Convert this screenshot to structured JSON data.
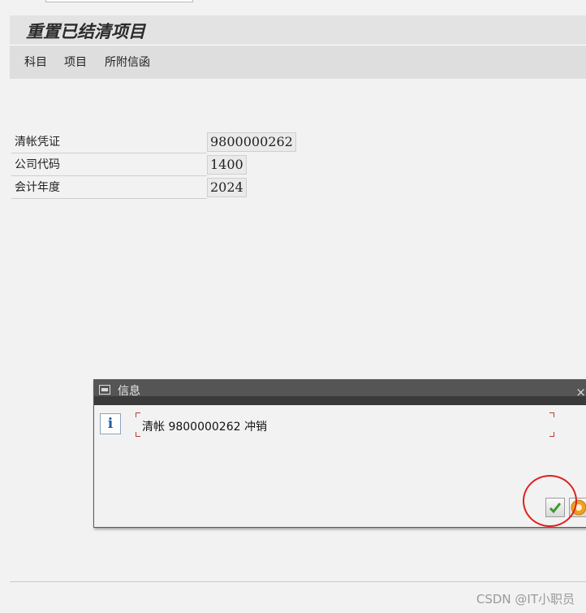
{
  "page": {
    "title": "重置已结清项目"
  },
  "menu": {
    "items": [
      {
        "label": "科目"
      },
      {
        "label": "项目"
      },
      {
        "label": "所附信函"
      }
    ]
  },
  "form": {
    "rows": [
      {
        "label": "清帐凭证",
        "value": "9800000262"
      },
      {
        "label": "公司代码",
        "value": "1400"
      },
      {
        "label": "会计年度",
        "value": "2024"
      }
    ]
  },
  "dialog": {
    "title": "信息",
    "close_symbol": "×",
    "info_icon_glyph": "i",
    "message": "清帐 9800000262 冲销"
  },
  "footer": {
    "watermark": "CSDN @IT小职员"
  },
  "colors": {
    "highlight_circle": "#e02020",
    "confirm_check": "#3d9a2e",
    "help_icon": "#f0a020",
    "info_icon": "#1f5aa6"
  }
}
